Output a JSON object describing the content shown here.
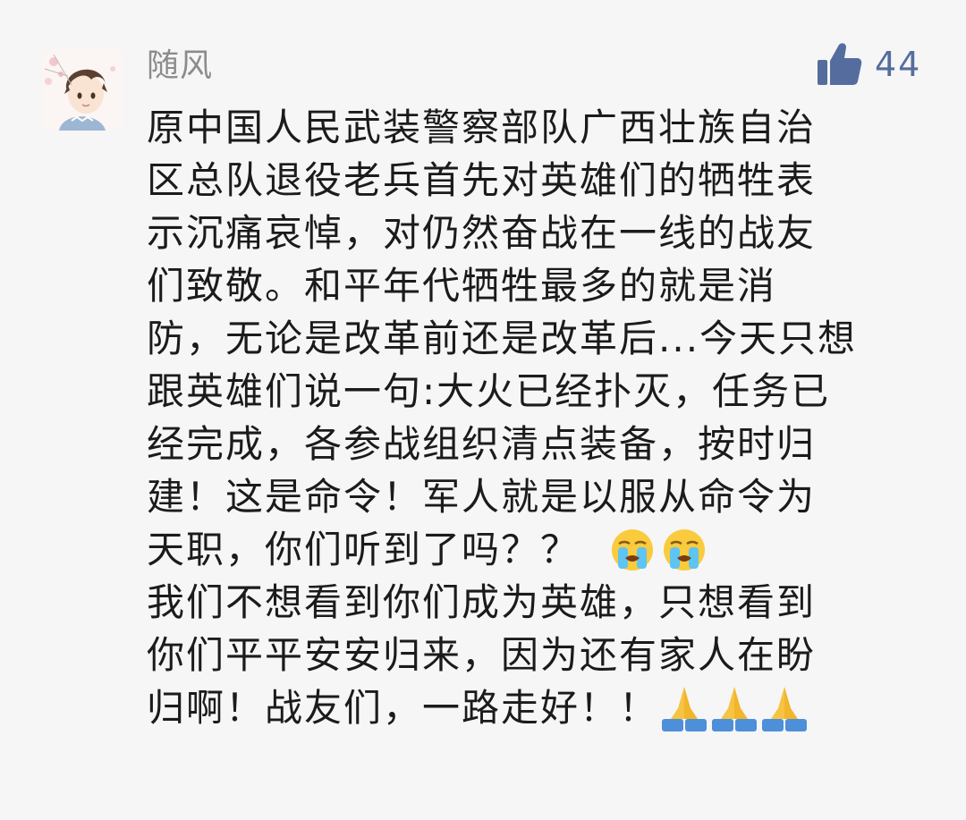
{
  "comment": {
    "username": "随风",
    "like_count": "44",
    "lines": [
      "原中国人民武装警察部队广西壮族自治",
      "区总队退役老兵首先对英雄们的牺牲表",
      "示沉痛哀悼，对仍然奋战在一线的战友",
      "们致敬。和平年代牺牲最多的就是消",
      "防，无论是改革前还是改革后...今天只想",
      "跟英雄们说一句:大火已经扑灭，任务已",
      "经完成，各参战组织清点装备，按时归",
      "建！这是命令！军人就是以服从命令为",
      "天职，你们听到了吗？？",
      "我们不想看到你们成为英雄，只想看到",
      "你们平平安安归来，因为还有家人在盼",
      "归啊！战友们，一路走好！！"
    ],
    "icons": {
      "avatar": "anime-boy-avatar",
      "like": "thumbs-up-icon",
      "cry": "loudly-crying-face-emoji",
      "pray": "folded-hands-emoji"
    },
    "colors": {
      "username": "#8c8c8c",
      "like": "#556d9e",
      "text": "#1b1b1b",
      "background": "#f6f6f6"
    }
  }
}
